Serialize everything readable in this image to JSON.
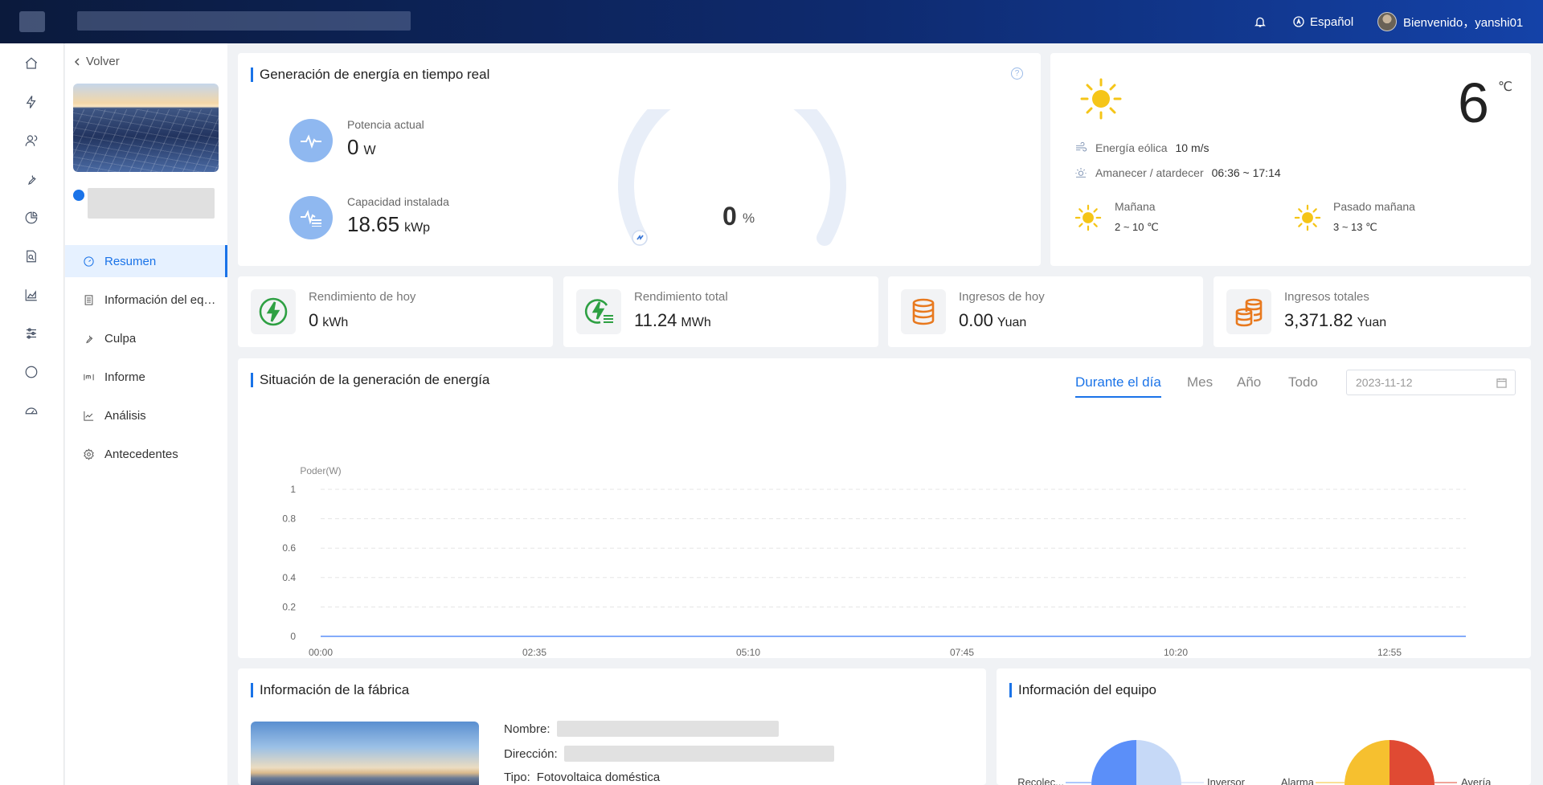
{
  "topbar": {
    "language": "Español",
    "welcome": "Bienvenido，yanshi01"
  },
  "plant_nav": {
    "back_label": "Volver",
    "items": [
      {
        "label": "Resumen",
        "icon": "gauge-icon",
        "active": true
      },
      {
        "label": "Información del equipo",
        "icon": "document-icon",
        "active": false
      },
      {
        "label": "Culpa",
        "icon": "wrench-icon",
        "active": false
      },
      {
        "label": "Informe",
        "icon": "report-icon",
        "active": false
      },
      {
        "label": "Análisis",
        "icon": "line-chart-icon",
        "active": false
      },
      {
        "label": "Antecedentes",
        "icon": "gear-icon",
        "active": false
      }
    ]
  },
  "realtime": {
    "title": "Generación de energía en tiempo real",
    "current_power_label": "Potencia actual",
    "current_power_value": "0",
    "current_power_unit": "W",
    "capacity_label": "Capacidad instalada",
    "capacity_value": "18.65",
    "capacity_unit": "kWp",
    "gauge_value": "0",
    "gauge_unit": "%",
    "gauge_fraction": 0
  },
  "weather": {
    "temperature": "6",
    "temperature_unit": "℃",
    "wind_label": "Energía eólica",
    "wind_value": "10 m/s",
    "sun_label": "Amanecer / atardecer",
    "sun_value": "06:36 ~ 17:14",
    "tomorrow_label": "Mañana",
    "tomorrow_range": "2 ~ 10 ℃",
    "after_label": "Pasado mañana",
    "after_range": "3 ~ 13 ℃",
    "colors": {
      "sun": "#f5c518"
    }
  },
  "stats": [
    {
      "label": "Rendimiento de hoy",
      "value": "0",
      "unit": "kWh",
      "icon": "lightning-icon",
      "color": "#2ea043"
    },
    {
      "label": "Rendimiento total",
      "value": "11.24",
      "unit": "MWh",
      "icon": "lightning-stack-icon",
      "color": "#2ea043"
    },
    {
      "label": "Ingresos de hoy",
      "value": "0.00",
      "unit": "Yuan",
      "icon": "coins-icon",
      "color": "#e8791e"
    },
    {
      "label": "Ingresos totales",
      "value": "3,371.82",
      "unit": "Yuan",
      "icon": "coins-stack-icon",
      "color": "#e8791e"
    }
  ],
  "generation": {
    "title": "Situación de la generación de energía",
    "tabs": [
      "Durante el día",
      "Mes",
      "Año",
      "Todo"
    ],
    "active_tab": 0,
    "date": "2023-11-12"
  },
  "chart_data": {
    "type": "line",
    "ylabel": "Poder(W)",
    "xlabel": "",
    "x_ticks": [
      "00:00",
      "02:35",
      "05:10",
      "07:45",
      "10:20",
      "12:55"
    ],
    "y_ticks": [
      "0",
      "0.2",
      "0.4",
      "0.6",
      "0.8",
      "1"
    ],
    "ylim": [
      0,
      1
    ],
    "grid": true,
    "series": [
      {
        "values": [
          0,
          0,
          0,
          0,
          0,
          0
        ]
      }
    ],
    "colors": {
      "line": "#5b8ff9",
      "grid": "#e5e5e5"
    }
  },
  "fabrica": {
    "title": "Información de la fábrica",
    "name_label": "Nombre:",
    "address_label": "Dirección:",
    "type_label": "Tipo:",
    "type_value": "Fotovoltaica doméstica"
  },
  "equipo": {
    "title": "Información del equipo",
    "pie1_labels": [
      "Recolec...",
      "Inversor"
    ],
    "pie2_labels": [
      "Alarma",
      "Avería"
    ],
    "colors": {
      "blue_dark": "#5b8ff9",
      "blue_light": "#c6d9f7",
      "yellow": "#f6c02f",
      "red": "#e04a33"
    }
  }
}
